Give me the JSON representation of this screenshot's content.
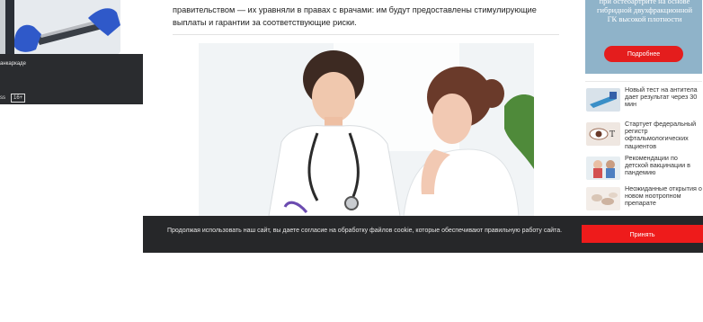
{
  "left_promo": {
    "caption": "анкаркаде",
    "meta_text": "ss",
    "age_badge": "16+"
  },
  "article": {
    "clipped_line": "",
    "line1": "правительством — их уравняли в правах с врачами: им будут предоставлены стимулирующие",
    "line2": "выплаты и гарантии за соответствующие риски."
  },
  "rail_ad": {
    "text": "при остеоартрите на основе гибридной двухфракционной ГК высокой плотности",
    "button": "Подробнее"
  },
  "news": [
    {
      "title": "Новый тест на антитела дает результат через 30 мин",
      "icon": "pipette-icon"
    },
    {
      "title": "Стартует федеральный регистр офтальмологических пациентов",
      "icon": "eye-icon"
    },
    {
      "title": "Рекомендации по детской вакцинации в пандемию",
      "icon": "child-icon"
    },
    {
      "title": "Неожиданные открытия о новом ноотропном препарате",
      "icon": "pills-icon"
    }
  ],
  "cookie": {
    "text": "Продолжая использовать наш сайт, вы даете согласие на обработку файлов cookie, которые обеспечивают правильную работу сайта.",
    "accept": "Принять"
  },
  "colors": {
    "accent_red": "#ee1b1b",
    "cookie_bg": "#262729",
    "ad_bg": "#8fb3c9"
  }
}
